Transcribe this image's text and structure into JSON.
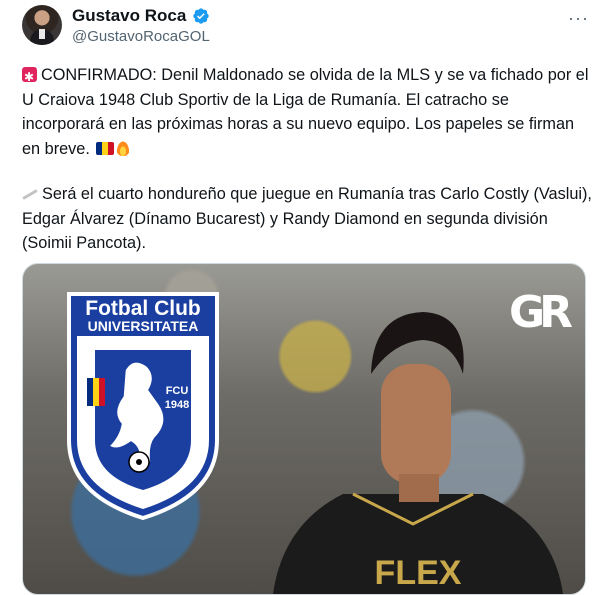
{
  "tweet": {
    "author": {
      "display_name": "Gustavo Roca",
      "handle": "@GustavoRocaGOL",
      "verified": true,
      "avatar_icon": "person-avatar-icon"
    },
    "more_icon": "more-horizontal-icon",
    "paragraph1": "CONFIRMADO: Denil Maldonado se olvida de la MLS y se va fichado por el U Craiova 1948 Club Sportiv de la Liga de Rumanía. El catracho se incorporará en las próximas horas a su nuevo equipo. Los papeles se firman en breve.",
    "paragraph2": "Será el cuarto hondureño que juegue en Rumanía tras Carlo Costly (Vaslui), Edgar Álvarez (Dínamo Bucarest) y Randy Diamond en segunda división  (Soimii Pancota).",
    "emojis": [
      "siren-icon",
      "romania-flag-icon",
      "fire-icon",
      "writing-hand-icon"
    ],
    "media": {
      "crest_line1": "Fotbal Club",
      "crest_line2": "UNIVERSITATEA",
      "crest_fcu": "FCU",
      "crest_year": "1948",
      "watermark": "GR",
      "jersey_sponsor": "FLEX"
    }
  },
  "colors": {
    "text": "#0f1419",
    "secondary": "#536471",
    "verified_blue": "#1d9bf0",
    "crest_blue": "#1a3fa0"
  }
}
